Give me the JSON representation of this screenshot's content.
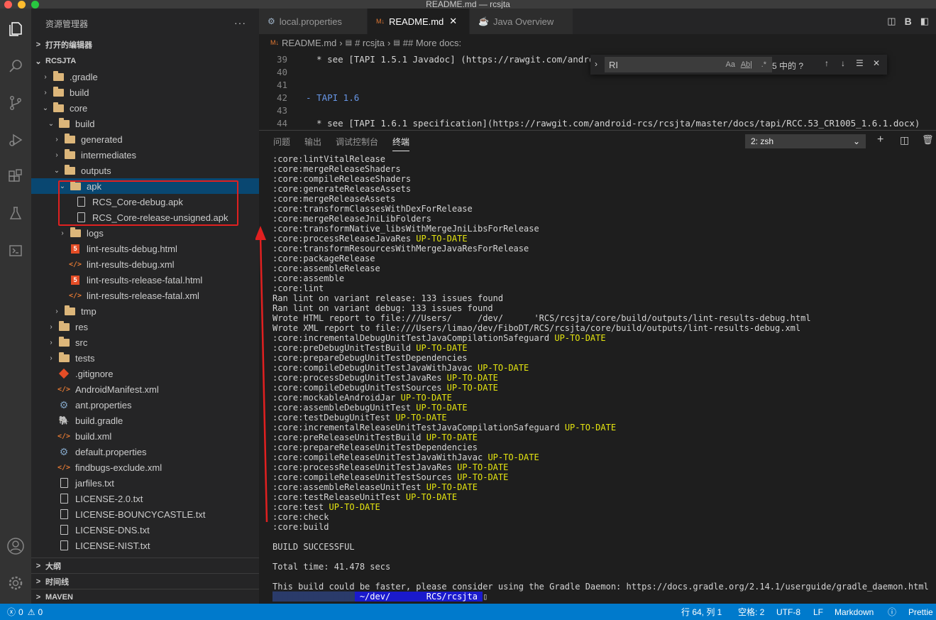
{
  "window": {
    "title": "README.md — rcsjta"
  },
  "activity_bar": {
    "icons": [
      "explorer-icon",
      "search-icon",
      "source-control-icon",
      "run-debug-icon",
      "extensions-icon",
      "testing-icon",
      "remote-icon",
      "account-icon",
      "manage-gear-icon"
    ]
  },
  "sidebar": {
    "header": "资源管理器",
    "open_editors": "打开的编辑器",
    "root": "RCSJTA",
    "tree": [
      {
        "label": ".gradle",
        "depth": 1,
        "kind": "folder",
        "chev": ">"
      },
      {
        "label": "build",
        "depth": 1,
        "kind": "folder",
        "chev": ">"
      },
      {
        "label": "core",
        "depth": 1,
        "kind": "folder",
        "chev": "v"
      },
      {
        "label": "build",
        "depth": 2,
        "kind": "folder",
        "chev": "v"
      },
      {
        "label": "generated",
        "depth": 3,
        "kind": "folder",
        "chev": ">"
      },
      {
        "label": "intermediates",
        "depth": 3,
        "kind": "folder",
        "chev": ">"
      },
      {
        "label": "outputs",
        "depth": 3,
        "kind": "folder",
        "chev": "v"
      },
      {
        "label": "apk",
        "depth": 4,
        "kind": "folder",
        "chev": "v"
      },
      {
        "label": "RCS_Core-debug.apk",
        "depth": 5,
        "kind": "file",
        "chev": ""
      },
      {
        "label": "RCS_Core-release-unsigned.apk",
        "depth": 5,
        "kind": "file",
        "chev": ""
      },
      {
        "label": "logs",
        "depth": 4,
        "kind": "folder",
        "chev": ">"
      },
      {
        "label": "lint-results-debug.html",
        "depth": 4,
        "kind": "html",
        "chev": ""
      },
      {
        "label": "lint-results-debug.xml",
        "depth": 4,
        "kind": "xml",
        "chev": ""
      },
      {
        "label": "lint-results-release-fatal.html",
        "depth": 4,
        "kind": "html",
        "chev": ""
      },
      {
        "label": "lint-results-release-fatal.xml",
        "depth": 4,
        "kind": "xml",
        "chev": ""
      },
      {
        "label": "tmp",
        "depth": 3,
        "kind": "folder",
        "chev": ">"
      },
      {
        "label": "res",
        "depth": 2,
        "kind": "folder",
        "chev": ">"
      },
      {
        "label": "src",
        "depth": 2,
        "kind": "folder",
        "chev": ">"
      },
      {
        "label": "tests",
        "depth": 2,
        "kind": "folder",
        "chev": ">"
      },
      {
        "label": ".gitignore",
        "depth": 2,
        "kind": "git",
        "chev": ""
      },
      {
        "label": "AndroidManifest.xml",
        "depth": 2,
        "kind": "xml",
        "chev": ""
      },
      {
        "label": "ant.properties",
        "depth": 2,
        "kind": "gear",
        "chev": ""
      },
      {
        "label": "build.gradle",
        "depth": 2,
        "kind": "gradle",
        "chev": ""
      },
      {
        "label": "build.xml",
        "depth": 2,
        "kind": "xml",
        "chev": ""
      },
      {
        "label": "default.properties",
        "depth": 2,
        "kind": "gear",
        "chev": ""
      },
      {
        "label": "findbugs-exclude.xml",
        "depth": 2,
        "kind": "xml",
        "chev": ""
      },
      {
        "label": "jarfiles.txt",
        "depth": 2,
        "kind": "file",
        "chev": ""
      },
      {
        "label": "LICENSE-2.0.txt",
        "depth": 2,
        "kind": "file",
        "chev": ""
      },
      {
        "label": "LICENSE-BOUNCYCASTLE.txt",
        "depth": 2,
        "kind": "file",
        "chev": ""
      },
      {
        "label": "LICENSE-DNS.txt",
        "depth": 2,
        "kind": "file",
        "chev": ""
      },
      {
        "label": "LICENSE-NIST.txt",
        "depth": 2,
        "kind": "file",
        "chev": ""
      }
    ],
    "outline": "大纲",
    "timeline": "时间线",
    "maven": "MAVEN"
  },
  "tabs": [
    {
      "label": "local.properties",
      "active": false
    },
    {
      "label": "README.md",
      "active": true
    },
    {
      "label": "Java Overview",
      "active": false
    }
  ],
  "tab_actions": {
    "bold": "B"
  },
  "breadcrumb": [
    "README.md",
    "# rcsjta",
    "## More docs:"
  ],
  "editor": {
    "lines": [
      {
        "num": "39",
        "text": "  * see [TAPI 1.5.1 Javadoc] (https://rawgit.com/androi"
      },
      {
        "num": "40",
        "text": ""
      },
      {
        "num": "41",
        "text": ""
      },
      {
        "num": "42",
        "text": "- TAPI 1.6"
      },
      {
        "num": "43",
        "text": ""
      },
      {
        "num": "44",
        "text": "  * see [TAPI 1.6.1 specification](https://rawgit.com/android-rcs/rcsjta/master/docs/tapi/RCC.53_CR1005_1.6.1.docx)"
      }
    ]
  },
  "find_widget": {
    "query": "RI",
    "match_case": "Aa",
    "whole_word": "Ab|",
    "regex": ".*",
    "result": "5 中的 ?"
  },
  "panel": {
    "tabs": [
      "问题",
      "输出",
      "调试控制台",
      "终端"
    ],
    "active_tab": "终端",
    "terminal_select": "2: zsh"
  },
  "terminal": {
    "lines": [
      [
        ":core:lintVitalRelease",
        ""
      ],
      [
        ":core:mergeReleaseShaders",
        ""
      ],
      [
        ":core:compileReleaseShaders",
        ""
      ],
      [
        ":core:generateReleaseAssets",
        ""
      ],
      [
        ":core:mergeReleaseAssets",
        ""
      ],
      [
        ":core:transformClassesWithDexForRelease",
        ""
      ],
      [
        ":core:mergeReleaseJniLibFolders",
        ""
      ],
      [
        ":core:transformNative_libsWithMergeJniLibsForRelease",
        ""
      ],
      [
        ":core:processReleaseJavaRes ",
        "UP-TO-DATE"
      ],
      [
        ":core:transformResourcesWithMergeJavaResForRelease",
        ""
      ],
      [
        ":core:packageRelease",
        ""
      ],
      [
        ":core:assembleRelease",
        ""
      ],
      [
        ":core:assemble",
        ""
      ],
      [
        ":core:lint",
        ""
      ],
      [
        "Ran lint on variant release: 133 issues found",
        ""
      ],
      [
        "Ran lint on variant debug: 133 issues found",
        ""
      ],
      [
        "Wrote HTML report to file:///Users/     /dev/      'RCS/rcsjta/core/build/outputs/lint-results-debug.html",
        ""
      ],
      [
        "Wrote XML report to file:///Users/limao/dev/FiboDT/RCS/rcsjta/core/build/outputs/lint-results-debug.xml",
        ""
      ],
      [
        ":core:incrementalDebugUnitTestJavaCompilationSafeguard ",
        "UP-TO-DATE"
      ],
      [
        ":core:preDebugUnitTestBuild ",
        "UP-TO-DATE"
      ],
      [
        ":core:prepareDebugUnitTestDependencies",
        ""
      ],
      [
        ":core:compileDebugUnitTestJavaWithJavac ",
        "UP-TO-DATE"
      ],
      [
        ":core:processDebugUnitTestJavaRes ",
        "UP-TO-DATE"
      ],
      [
        ":core:compileDebugUnitTestSources ",
        "UP-TO-DATE"
      ],
      [
        ":core:mockableAndroidJar ",
        "UP-TO-DATE"
      ],
      [
        ":core:assembleDebugUnitTest ",
        "UP-TO-DATE"
      ],
      [
        ":core:testDebugUnitTest ",
        "UP-TO-DATE"
      ],
      [
        ":core:incrementalReleaseUnitTestJavaCompilationSafeguard ",
        "UP-TO-DATE"
      ],
      [
        ":core:preReleaseUnitTestBuild ",
        "UP-TO-DATE"
      ],
      [
        ":core:prepareReleaseUnitTestDependencies",
        ""
      ],
      [
        ":core:compileReleaseUnitTestJavaWithJavac ",
        "UP-TO-DATE"
      ],
      [
        ":core:processReleaseUnitTestJavaRes ",
        "UP-TO-DATE"
      ],
      [
        ":core:compileReleaseUnitTestSources ",
        "UP-TO-DATE"
      ],
      [
        ":core:assembleReleaseUnitTest ",
        "UP-TO-DATE"
      ],
      [
        ":core:testReleaseUnitTest ",
        "UP-TO-DATE"
      ],
      [
        ":core:test ",
        "UP-TO-DATE"
      ],
      [
        ":core:check",
        ""
      ],
      [
        ":core:build",
        ""
      ],
      [
        "",
        ""
      ],
      [
        "BUILD SUCCESSFUL",
        ""
      ],
      [
        "",
        ""
      ],
      [
        "Total time: 41.478 secs",
        ""
      ],
      [
        "",
        ""
      ],
      [
        "This build could be faster, please consider using the Gradle Daemon: https://docs.gradle.org/2.14.1/userguide/gradle_daemon.html",
        ""
      ]
    ],
    "prompt": " ~/dev/       RCS/rcsjta "
  },
  "statusbar": {
    "errors": "0",
    "warnings": "0",
    "position": "行 64, 列 1",
    "spaces": "空格: 2",
    "encoding": "UTF-8",
    "eol": "LF",
    "language": "Markdown",
    "formatter": "Prettie"
  },
  "colors": {
    "accent": "#007acc",
    "selection": "#094771",
    "annotation_red": "#e02020",
    "terminal_yellow": "#e5e510"
  }
}
